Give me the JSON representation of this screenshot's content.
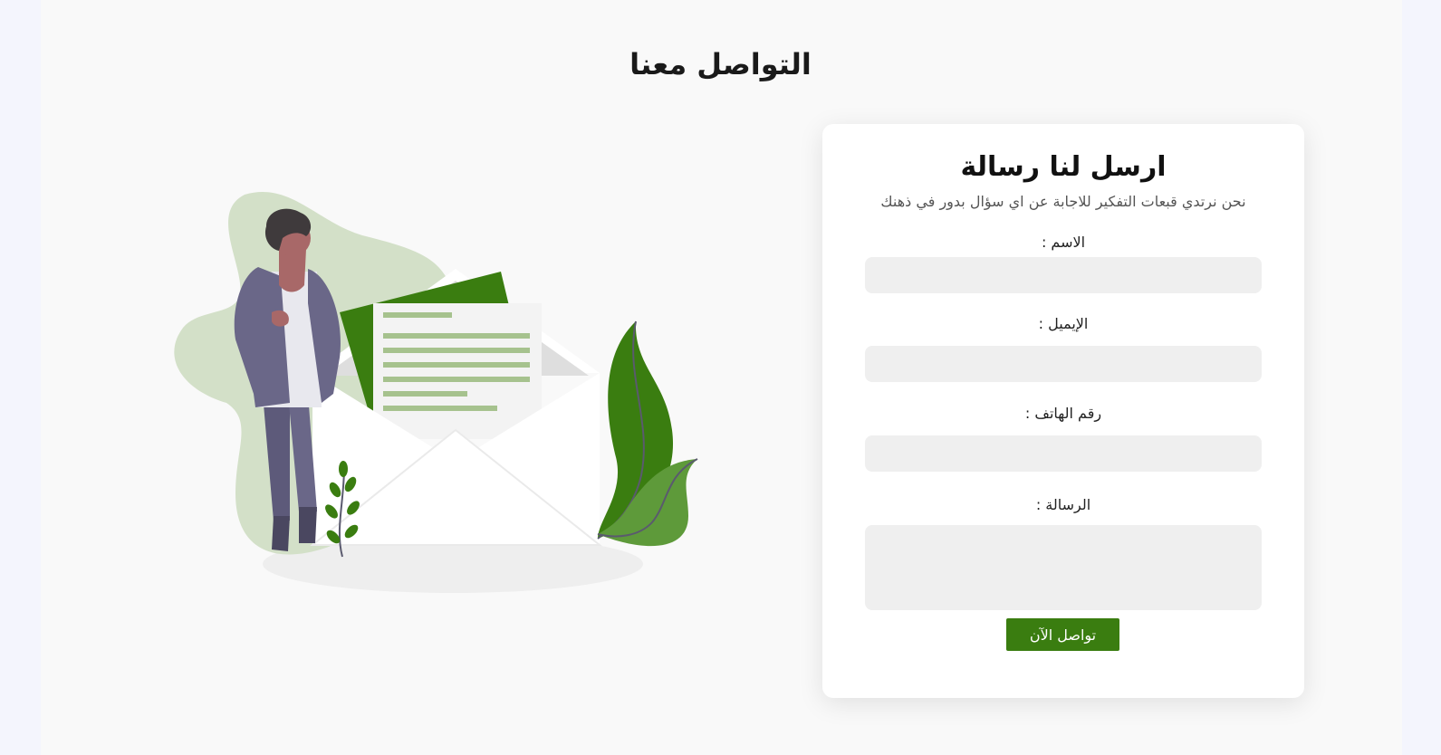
{
  "page": {
    "title": "التواصل معنا"
  },
  "form": {
    "title": "ارسل لنا رسالة",
    "subtitle": "نحن نرتدي قبعات التفكير للاجابة عن اي سؤال بدور في ذهنك",
    "fields": [
      {
        "label": "الاسم :",
        "value": ""
      },
      {
        "label": "الإيميل :",
        "value": ""
      },
      {
        "label": "رقم الهاتف :",
        "value": ""
      },
      {
        "label": "الرسالة :",
        "value": ""
      }
    ],
    "submit_label": "تواصل الآن"
  },
  "illustration": {
    "icon": "person-with-envelope-illustration",
    "colors": {
      "accent": "#3a7d10",
      "blob": "#d3e0c8",
      "leaf_light": "#5e9a3a"
    }
  },
  "colors": {
    "accent": "#3a7d10",
    "page_bg": "#f9f9f9",
    "card_bg": "#ffffff",
    "input_bg": "#efefef"
  }
}
